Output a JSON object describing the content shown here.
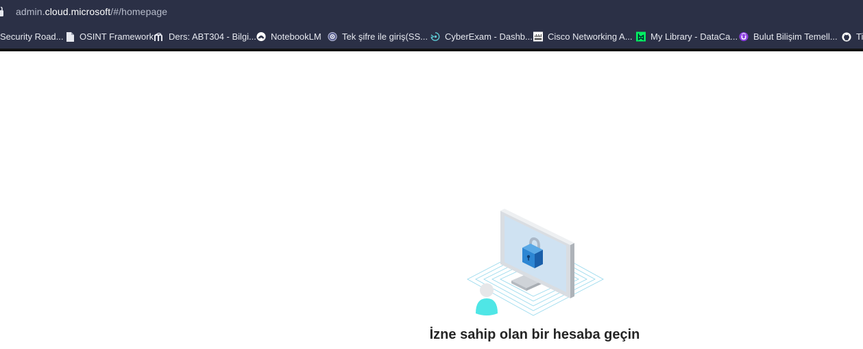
{
  "address_bar": {
    "url_prefix": "admin.",
    "url_domain": "cloud.microsoft",
    "url_path": "/#/homepage"
  },
  "bookmarks": [
    {
      "label": "Security Road...",
      "icon": "none"
    },
    {
      "label": "OSINT Framework",
      "icon": "document-icon"
    },
    {
      "label": "Ders: ABT304 - Bilgi...",
      "icon": "moodle-icon"
    },
    {
      "label": "NotebookLM",
      "icon": "notebooklm-icon"
    },
    {
      "label": "Tek şifre ile giriş(SS...",
      "icon": "globe-icon"
    },
    {
      "label": "CyberExam - Dashb...",
      "icon": "cyberexam-icon"
    },
    {
      "label": "Cisco Networking A...",
      "icon": "cisco-icon"
    },
    {
      "label": "My Library - DataCa...",
      "icon": "datacamp-icon"
    },
    {
      "label": "Bulut Bilişim Temell...",
      "icon": "udemy-icon"
    },
    {
      "label": "Ti",
      "icon": "github-icon"
    }
  ],
  "content": {
    "message": "İzne sahip olan bir hesaba geçin",
    "illustration": "locked-computer-illustration"
  },
  "colors": {
    "browser_chrome": "#2b3046",
    "page_background": "#ffffff",
    "message_text": "#252525"
  }
}
